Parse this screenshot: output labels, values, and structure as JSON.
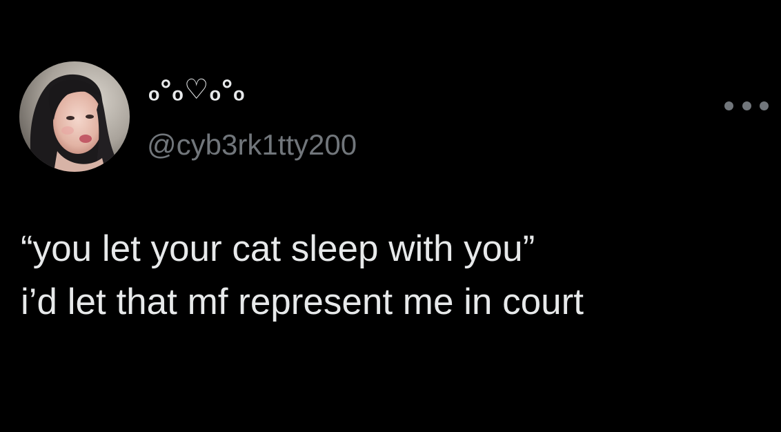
{
  "tweet": {
    "author": {
      "display_name": "ₒ°ₒ♡ₒ°ₒ",
      "handle": "@cyb3rk1tty200",
      "avatar": "profile-photo"
    },
    "more_icon": "more-horizontal-icon",
    "text_lines": [
      "“you let your cat sleep with you”",
      "i’d let that mf represent me in court"
    ]
  },
  "colors": {
    "background": "#000000",
    "primary_text": "#e7e9ea",
    "secondary_text": "#71767b"
  }
}
